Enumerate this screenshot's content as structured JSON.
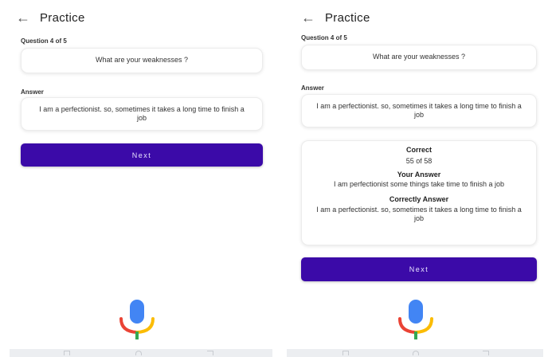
{
  "left": {
    "title": "Practice",
    "question_counter": "Question 4 of 5",
    "question": "What are your weaknesses ?",
    "answer_label": "Answer",
    "answer": "I am a perfectionist. so, sometimes it takes a long time to finish a job",
    "next_label": "Next"
  },
  "right": {
    "title": "Practice",
    "question_counter": "Question 4 of 5",
    "question": "What are your weaknesses ?",
    "answer_label": "Answer",
    "answer": "I am a perfectionist. so, sometimes it takes a long time to finish a job",
    "result": {
      "correct_label": "Correct",
      "score": "55 of 58",
      "your_answer_label": "Your Answer",
      "your_answer": "I am perfectionist some things take time to finish a job",
      "correct_answer_label": "Correctly Answer",
      "correct_answer": "I am a perfectionist. so, sometimes it takes a long time to finish a job"
    },
    "next_label": "Next"
  },
  "colors": {
    "primary_button": "#3b0aa8",
    "mic_blue": "#4285f4",
    "mic_red": "#ea4335",
    "mic_yellow": "#fbbc05",
    "mic_green": "#34a853"
  },
  "icons": {
    "back": "arrow-left-icon",
    "mic": "google-mic-icon"
  }
}
